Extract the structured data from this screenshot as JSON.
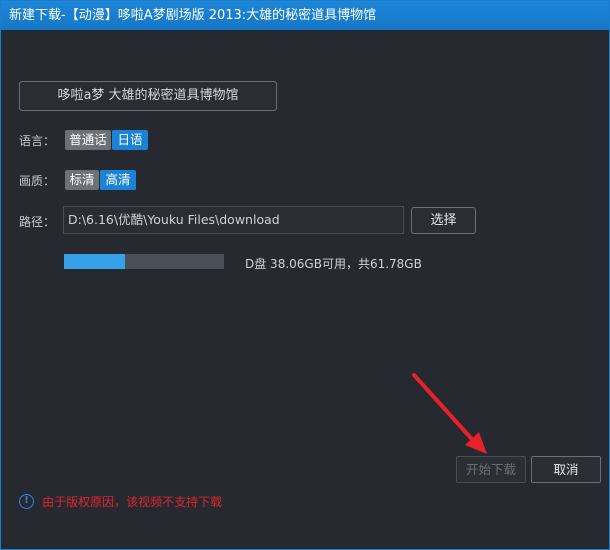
{
  "window": {
    "title": "新建下载-【动漫】哆啦A梦剧场版 2013:大雄的秘密道具博物馆"
  },
  "video": {
    "title_button": "哆啦a梦 大雄的秘密道具博物馆"
  },
  "language": {
    "label": "语言：",
    "options": [
      "普通话",
      "日语"
    ],
    "selected": "日语"
  },
  "quality": {
    "label": "画质：",
    "options": [
      "标清",
      "高清"
    ],
    "selected": "高清"
  },
  "path": {
    "label": "路径：",
    "value": "D:\\6.16\\优酷\\Youku Files\\download",
    "choose_button": "选择"
  },
  "disk": {
    "used_fraction": 0.384,
    "info": "D盘 38.06GB可用，共61.78GB"
  },
  "actions": {
    "start": "开始下载",
    "cancel": "取消"
  },
  "notice": {
    "icon_glyph": "!",
    "text": "由于版权原因，该视频不支持下载"
  },
  "colors": {
    "accent": "#1b82d6",
    "warning": "#e0242c",
    "annotation_arrow": "#e8202a"
  }
}
